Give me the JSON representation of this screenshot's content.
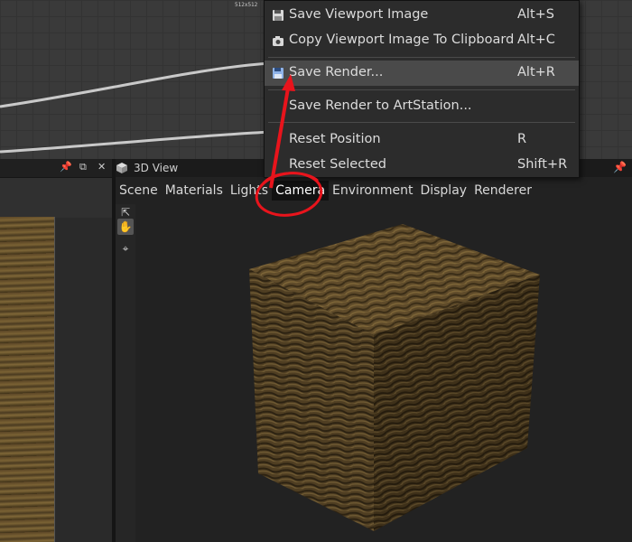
{
  "graph": {
    "resolution_label": "512x512"
  },
  "left_panel": {
    "close_glyph": "✕"
  },
  "view3d": {
    "title": "3D View",
    "menu": [
      "Scene",
      "Materials",
      "Lights",
      "Camera",
      "Environment",
      "Display",
      "Renderer"
    ],
    "active_menu": "Camera"
  },
  "context_menu": {
    "items": [
      {
        "label": "Save Viewport Image",
        "shortcut": "Alt+S",
        "icon": "save-icon"
      },
      {
        "label": "Copy Viewport Image To Clipboard",
        "shortcut": "Alt+C",
        "icon": "camera-icon"
      },
      {
        "label": "Save Render...",
        "shortcut": "Alt+R",
        "icon": "save-icon",
        "highlighted": true
      },
      {
        "label": "Save Render to ArtStation...",
        "shortcut": ""
      },
      {
        "label": "Reset Position",
        "shortcut": "R"
      },
      {
        "label": "Reset Selected",
        "shortcut": "Shift+R"
      }
    ]
  },
  "colors": {
    "annotation_red": "#e8141c",
    "menu_bg": "#2c2c2c",
    "highlight_bg": "#4a4a4a"
  }
}
